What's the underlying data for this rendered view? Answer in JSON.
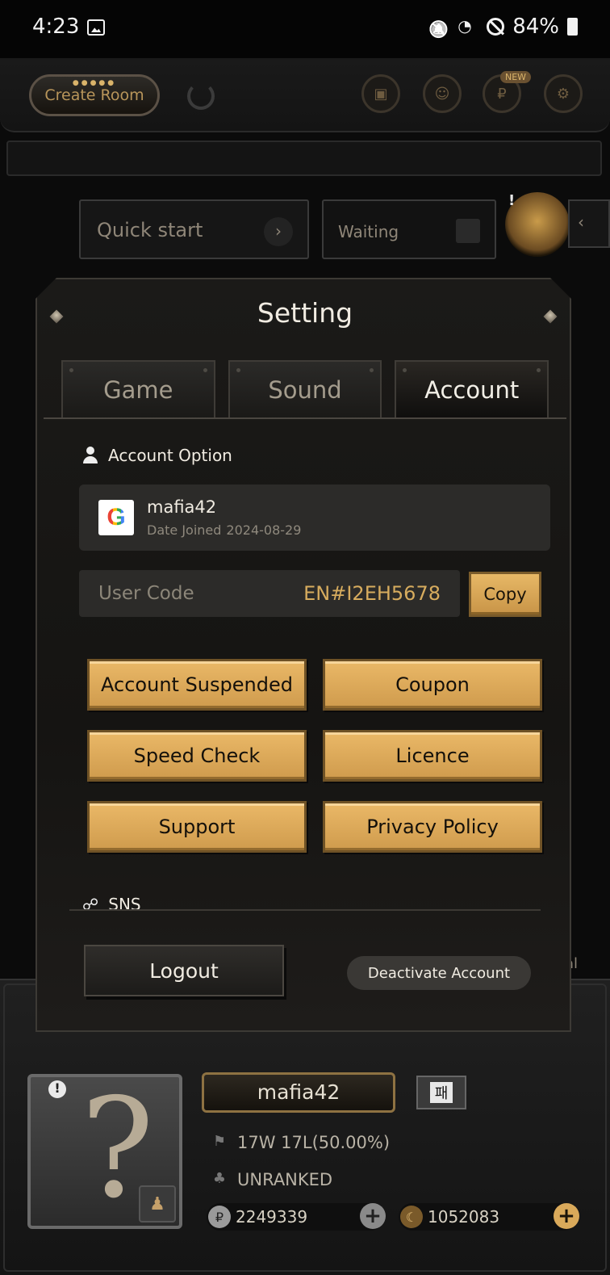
{
  "status_bar": {
    "time": "4:23",
    "battery": "84%"
  },
  "topbar": {
    "create_room": "Create Room",
    "new_badge": "NEW"
  },
  "lobby": {
    "quick_start": "Quick start",
    "waiting": "Waiting"
  },
  "modal": {
    "title": "Setting",
    "tabs": [
      "Game",
      "Sound",
      "Account"
    ],
    "active_tab": "Account",
    "account_option_label": "Account Option",
    "account": {
      "name": "mafia42",
      "date_joined_label": "Date Joined",
      "date_joined": "2024-08-29"
    },
    "user_code": {
      "label": "User Code",
      "value": "EN#I2EH5678",
      "copy_label": "Copy"
    },
    "buttons": [
      "Account Suspended",
      "Coupon",
      "Speed Check",
      "Licence",
      "Support",
      "Privacy Policy"
    ],
    "sns_label": "SNS",
    "logout_label": "Logout",
    "deactivate_label": "Deactivate Account"
  },
  "profile": {
    "name": "mafia42",
    "tag": "패",
    "record": "17W 17L(50.00%)",
    "rank": "UNRANKED",
    "coins": "2249339",
    "moons": "1052083",
    "side_label": "al"
  },
  "colors": {
    "gold": "#d9a95a",
    "bg": "#151412",
    "accent_text": "#d7ac5e"
  },
  "icons": [
    "image-icon",
    "mute-icon",
    "wifi-icon",
    "no-disturb-icon",
    "battery-icon",
    "refresh-icon",
    "person-icon",
    "google-icon",
    "link-icon",
    "flag-icon",
    "trophy-icon",
    "coin-icon",
    "moon-icon",
    "plus-icon"
  ]
}
